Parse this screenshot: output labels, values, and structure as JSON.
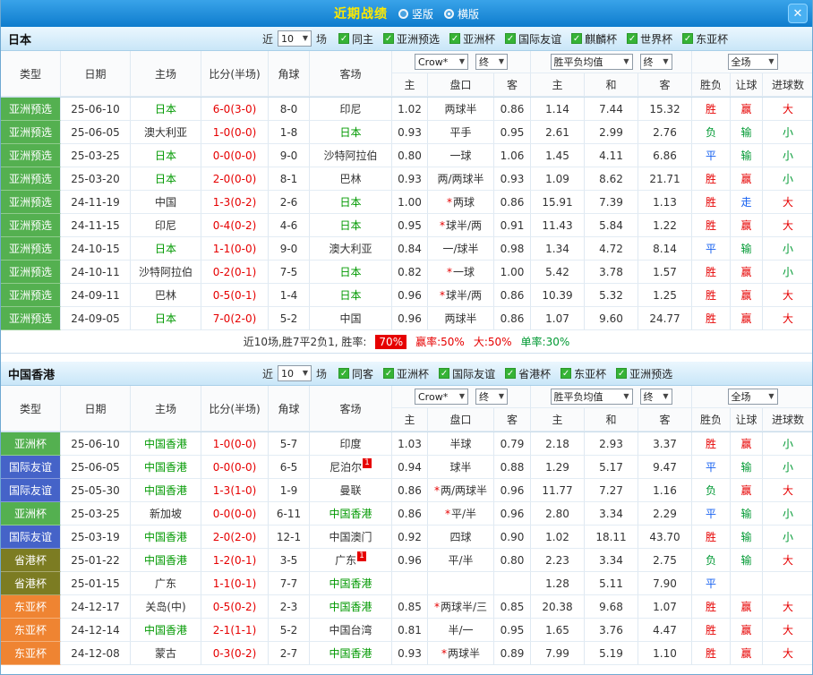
{
  "topbar": {
    "title": "近期战绩",
    "layout_options": [
      {
        "label": "竖版",
        "selected": false
      },
      {
        "label": "横版",
        "selected": true
      }
    ],
    "close_label": "✕"
  },
  "icons": {
    "chevron_down": "▼",
    "check": "✓",
    "close": "✕"
  },
  "near_label": "近",
  "games_suffix": "场",
  "controls": {
    "crow": "Crow*",
    "final1": "终",
    "wdl_avg": "胜平负均值",
    "final2": "终",
    "full_match": "全场"
  },
  "columns": [
    "类型",
    "日期",
    "主场",
    "比分(半场)",
    "角球",
    "客场",
    "主",
    "盘口",
    "客",
    "主",
    "和",
    "客",
    "胜负",
    "让球",
    "进球数"
  ],
  "sections": [
    {
      "team": "日本",
      "games_value": "10",
      "checkboxes": [
        {
          "label": "同主",
          "checked": true
        },
        {
          "label": "亚洲预选",
          "checked": true
        },
        {
          "label": "亚洲杯",
          "checked": true
        },
        {
          "label": "国际友谊",
          "checked": true
        },
        {
          "label": "麒麟杯",
          "checked": true
        },
        {
          "label": "世界杯",
          "checked": true
        },
        {
          "label": "东亚杯",
          "checked": true
        }
      ],
      "rows": [
        {
          "type": "亚洲预选",
          "type_color": "green",
          "date": "25-06-10",
          "home": "日本",
          "home_focal": true,
          "home_badge": "",
          "score": "6-0(3-0)",
          "corners": "8-0",
          "away": "印尼",
          "away_focal": false,
          "away_badge": "",
          "asia_home": "1.02",
          "handicap": "两球半",
          "asia_away": "0.86",
          "eu_home": "1.14",
          "eu_draw": "7.44",
          "eu_away": "15.32",
          "result": [
            "胜",
            "r"
          ],
          "handicap_result": [
            "赢",
            "r"
          ],
          "goals": [
            "大",
            "r"
          ]
        },
        {
          "type": "亚洲预选",
          "type_color": "green",
          "date": "25-06-05",
          "home": "澳大利亚",
          "home_focal": false,
          "home_badge": "",
          "score": "1-0(0-0)",
          "corners": "1-8",
          "away": "日本",
          "away_focal": true,
          "away_badge": "",
          "asia_home": "0.93",
          "handicap": "平手",
          "asia_away": "0.95",
          "eu_home": "2.61",
          "eu_draw": "2.99",
          "eu_away": "2.76",
          "result": [
            "负",
            "g"
          ],
          "handicap_result": [
            "输",
            "g"
          ],
          "goals": [
            "小",
            "g"
          ]
        },
        {
          "type": "亚洲预选",
          "type_color": "green",
          "date": "25-03-25",
          "home": "日本",
          "home_focal": true,
          "home_badge": "",
          "score": "0-0(0-0)",
          "corners": "9-0",
          "away": "沙特阿拉伯",
          "away_focal": false,
          "away_badge": "",
          "asia_home": "0.80",
          "handicap": "一球",
          "asia_away": "1.06",
          "eu_home": "1.45",
          "eu_draw": "4.11",
          "eu_away": "6.86",
          "result": [
            "平",
            "b"
          ],
          "handicap_result": [
            "输",
            "g"
          ],
          "goals": [
            "小",
            "g"
          ]
        },
        {
          "type": "亚洲预选",
          "type_color": "green",
          "date": "25-03-20",
          "home": "日本",
          "home_focal": true,
          "home_badge": "",
          "score": "2-0(0-0)",
          "corners": "8-1",
          "away": "巴林",
          "away_focal": false,
          "away_badge": "",
          "asia_home": "0.93",
          "handicap": "两/两球半",
          "asia_away": "0.93",
          "eu_home": "1.09",
          "eu_draw": "8.62",
          "eu_away": "21.71",
          "result": [
            "胜",
            "r"
          ],
          "handicap_result": [
            "赢",
            "r"
          ],
          "goals": [
            "小",
            "g"
          ]
        },
        {
          "type": "亚洲预选",
          "type_color": "green",
          "date": "24-11-19",
          "home": "中国",
          "home_focal": false,
          "home_badge": "",
          "score": "1-3(0-2)",
          "corners": "2-6",
          "away": "日本",
          "away_focal": true,
          "away_badge": "",
          "asia_home": "1.00",
          "handicap": "*两球",
          "asia_away": "0.86",
          "eu_home": "15.91",
          "eu_draw": "7.39",
          "eu_away": "1.13",
          "result": [
            "胜",
            "r"
          ],
          "handicap_result": [
            "走",
            "b"
          ],
          "goals": [
            "大",
            "r"
          ]
        },
        {
          "type": "亚洲预选",
          "type_color": "green",
          "date": "24-11-15",
          "home": "印尼",
          "home_focal": false,
          "home_badge": "",
          "score": "0-4(0-2)",
          "corners": "4-6",
          "away": "日本",
          "away_focal": true,
          "away_badge": "",
          "asia_home": "0.95",
          "handicap": "*球半/两",
          "asia_away": "0.91",
          "eu_home": "11.43",
          "eu_draw": "5.84",
          "eu_away": "1.22",
          "result": [
            "胜",
            "r"
          ],
          "handicap_result": [
            "赢",
            "r"
          ],
          "goals": [
            "大",
            "r"
          ]
        },
        {
          "type": "亚洲预选",
          "type_color": "green",
          "date": "24-10-15",
          "home": "日本",
          "home_focal": true,
          "home_badge": "",
          "score": "1-1(0-0)",
          "corners": "9-0",
          "away": "澳大利亚",
          "away_focal": false,
          "away_badge": "",
          "asia_home": "0.84",
          "handicap": "一/球半",
          "asia_away": "0.98",
          "eu_home": "1.34",
          "eu_draw": "4.72",
          "eu_away": "8.14",
          "result": [
            "平",
            "b"
          ],
          "handicap_result": [
            "输",
            "g"
          ],
          "goals": [
            "小",
            "g"
          ]
        },
        {
          "type": "亚洲预选",
          "type_color": "green",
          "date": "24-10-11",
          "home": "沙特阿拉伯",
          "home_focal": false,
          "home_badge": "",
          "score": "0-2(0-1)",
          "corners": "7-5",
          "away": "日本",
          "away_focal": true,
          "away_badge": "",
          "asia_home": "0.82",
          "handicap": "*一球",
          "asia_away": "1.00",
          "eu_home": "5.42",
          "eu_draw": "3.78",
          "eu_away": "1.57",
          "result": [
            "胜",
            "r"
          ],
          "handicap_result": [
            "赢",
            "r"
          ],
          "goals": [
            "小",
            "g"
          ]
        },
        {
          "type": "亚洲预选",
          "type_color": "green",
          "date": "24-09-11",
          "home": "巴林",
          "home_focal": false,
          "home_badge": "",
          "score": "0-5(0-1)",
          "corners": "1-4",
          "away": "日本",
          "away_focal": true,
          "away_badge": "",
          "asia_home": "0.96",
          "handicap": "*球半/两",
          "asia_away": "0.86",
          "eu_home": "10.39",
          "eu_draw": "5.32",
          "eu_away": "1.25",
          "result": [
            "胜",
            "r"
          ],
          "handicap_result": [
            "赢",
            "r"
          ],
          "goals": [
            "大",
            "r"
          ]
        },
        {
          "type": "亚洲预选",
          "type_color": "green",
          "date": "24-09-05",
          "home": "日本",
          "home_focal": true,
          "home_badge": "",
          "score": "7-0(2-0)",
          "corners": "5-2",
          "away": "中国",
          "away_focal": false,
          "away_badge": "",
          "asia_home": "0.96",
          "handicap": "两球半",
          "asia_away": "0.86",
          "eu_home": "1.07",
          "eu_draw": "9.60",
          "eu_away": "24.77",
          "result": [
            "胜",
            "r"
          ],
          "handicap_result": [
            "赢",
            "r"
          ],
          "goals": [
            "大",
            "r"
          ]
        }
      ],
      "summary": [
        {
          "text": "近10场,胜7平2负1, 胜率:",
          "style": "plain"
        },
        {
          "text": "70%",
          "style": "badge"
        },
        {
          "text": "赢率:50%",
          "style": "red"
        },
        {
          "text": "大:50%",
          "style": "red"
        },
        {
          "text": "单率:30%",
          "style": "green"
        }
      ]
    },
    {
      "team": "中国香港",
      "games_value": "10",
      "checkboxes": [
        {
          "label": "同客",
          "checked": true
        },
        {
          "label": "亚洲杯",
          "checked": true
        },
        {
          "label": "国际友谊",
          "checked": true
        },
        {
          "label": "省港杯",
          "checked": true
        },
        {
          "label": "东亚杯",
          "checked": true
        },
        {
          "label": "亚洲预选",
          "checked": true
        }
      ],
      "rows": [
        {
          "type": "亚洲杯",
          "type_color": "green",
          "date": "25-06-10",
          "home": "中国香港",
          "home_focal": true,
          "home_badge": "",
          "score": "1-0(0-0)",
          "corners": "5-7",
          "away": "印度",
          "away_focal": false,
          "away_badge": "",
          "asia_home": "1.03",
          "handicap": "半球",
          "asia_away": "0.79",
          "eu_home": "2.18",
          "eu_draw": "2.93",
          "eu_away": "3.37",
          "result": [
            "胜",
            "r"
          ],
          "handicap_result": [
            "赢",
            "r"
          ],
          "goals": [
            "小",
            "g"
          ]
        },
        {
          "type": "国际友谊",
          "type_color": "blue",
          "date": "25-06-05",
          "home": "中国香港",
          "home_focal": true,
          "home_badge": "",
          "score": "0-0(0-0)",
          "corners": "6-5",
          "away": "尼泊尔",
          "away_focal": false,
          "away_badge": "1",
          "asia_home": "0.94",
          "handicap": "球半",
          "asia_away": "0.88",
          "eu_home": "1.29",
          "eu_draw": "5.17",
          "eu_away": "9.47",
          "result": [
            "平",
            "b"
          ],
          "handicap_result": [
            "输",
            "g"
          ],
          "goals": [
            "小",
            "g"
          ]
        },
        {
          "type": "国际友谊",
          "type_color": "blue",
          "date": "25-05-30",
          "home": "中国香港",
          "home_focal": true,
          "home_badge": "",
          "score": "1-3(1-0)",
          "corners": "1-9",
          "away": "曼联",
          "away_focal": false,
          "away_badge": "",
          "asia_home": "0.86",
          "handicap": "*两/两球半",
          "asia_away": "0.96",
          "eu_home": "11.77",
          "eu_draw": "7.27",
          "eu_away": "1.16",
          "result": [
            "负",
            "g"
          ],
          "handicap_result": [
            "赢",
            "r"
          ],
          "goals": [
            "大",
            "r"
          ]
        },
        {
          "type": "亚洲杯",
          "type_color": "green",
          "date": "25-03-25",
          "home": "新加坡",
          "home_focal": false,
          "home_badge": "",
          "score": "0-0(0-0)",
          "corners": "6-11",
          "away": "中国香港",
          "away_focal": true,
          "away_badge": "",
          "asia_home": "0.86",
          "handicap": "*平/半",
          "asia_away": "0.96",
          "eu_home": "2.80",
          "eu_draw": "3.34",
          "eu_away": "2.29",
          "result": [
            "平",
            "b"
          ],
          "handicap_result": [
            "输",
            "g"
          ],
          "goals": [
            "小",
            "g"
          ]
        },
        {
          "type": "国际友谊",
          "type_color": "blue",
          "date": "25-03-19",
          "home": "中国香港",
          "home_focal": true,
          "home_badge": "",
          "score": "2-0(2-0)",
          "corners": "12-1",
          "away": "中国澳门",
          "away_focal": false,
          "away_badge": "",
          "asia_home": "0.92",
          "handicap": "四球",
          "asia_away": "0.90",
          "eu_home": "1.02",
          "eu_draw": "18.11",
          "eu_away": "43.70",
          "result": [
            "胜",
            "r"
          ],
          "handicap_result": [
            "输",
            "g"
          ],
          "goals": [
            "小",
            "g"
          ]
        },
        {
          "type": "省港杯",
          "type_color": "olive",
          "date": "25-01-22",
          "home": "中国香港",
          "home_focal": true,
          "home_badge": "",
          "score": "1-2(0-1)",
          "corners": "3-5",
          "away": "广东",
          "away_focal": false,
          "away_badge": "1",
          "asia_home": "0.96",
          "handicap": "平/半",
          "asia_away": "0.80",
          "eu_home": "2.23",
          "eu_draw": "3.34",
          "eu_away": "2.75",
          "result": [
            "负",
            "g"
          ],
          "handicap_result": [
            "输",
            "g"
          ],
          "goals": [
            "大",
            "r"
          ]
        },
        {
          "type": "省港杯",
          "type_color": "olive",
          "date": "25-01-15",
          "home": "广东",
          "home_focal": false,
          "home_badge": "",
          "score": "1-1(0-1)",
          "corners": "7-7",
          "away": "中国香港",
          "away_focal": true,
          "away_badge": "",
          "asia_home": "",
          "handicap": "",
          "asia_away": "",
          "eu_home": "1.28",
          "eu_draw": "5.11",
          "eu_away": "7.90",
          "result": [
            "平",
            "b"
          ],
          "handicap_result": [
            "",
            ""
          ],
          "goals": [
            "",
            ""
          ]
        },
        {
          "type": "东亚杯",
          "type_color": "orange",
          "date": "24-12-17",
          "home": "关岛(中)",
          "home_focal": false,
          "home_badge": "",
          "score": "0-5(0-2)",
          "corners": "2-3",
          "away": "中国香港",
          "away_focal": true,
          "away_badge": "",
          "asia_home": "0.85",
          "handicap": "*两球半/三",
          "asia_away": "0.85",
          "eu_home": "20.38",
          "eu_draw": "9.68",
          "eu_away": "1.07",
          "result": [
            "胜",
            "r"
          ],
          "handicap_result": [
            "赢",
            "r"
          ],
          "goals": [
            "大",
            "r"
          ]
        },
        {
          "type": "东亚杯",
          "type_color": "orange",
          "date": "24-12-14",
          "home": "中国香港",
          "home_focal": true,
          "home_badge": "",
          "score": "2-1(1-1)",
          "corners": "5-2",
          "away": "中国台湾",
          "away_focal": false,
          "away_badge": "",
          "asia_home": "0.81",
          "handicap": "半/一",
          "asia_away": "0.95",
          "eu_home": "1.65",
          "eu_draw": "3.76",
          "eu_away": "4.47",
          "result": [
            "胜",
            "r"
          ],
          "handicap_result": [
            "赢",
            "r"
          ],
          "goals": [
            "大",
            "r"
          ]
        },
        {
          "type": "东亚杯",
          "type_color": "orange",
          "date": "24-12-08",
          "home": "蒙古",
          "home_focal": false,
          "home_badge": "",
          "score": "0-3(0-2)",
          "corners": "2-7",
          "away": "中国香港",
          "away_focal": true,
          "away_badge": "",
          "asia_home": "0.93",
          "handicap": "*两球半",
          "asia_away": "0.89",
          "eu_home": "7.99",
          "eu_draw": "5.19",
          "eu_away": "1.10",
          "result": [
            "胜",
            "r"
          ],
          "handicap_result": [
            "赢",
            "r"
          ],
          "goals": [
            "大",
            "r"
          ]
        }
      ],
      "summary": null
    }
  ],
  "colors": {
    "accent_red": "#e60000",
    "win_green": "#009933",
    "draw_blue": "#1560f0",
    "type_green": "#54b050",
    "type_blue": "#4563c8",
    "type_olive": "#7c7c22",
    "type_orange": "#ef8432",
    "topbar_blue": "#0e7ccd",
    "title_yellow": "#ffe900"
  }
}
